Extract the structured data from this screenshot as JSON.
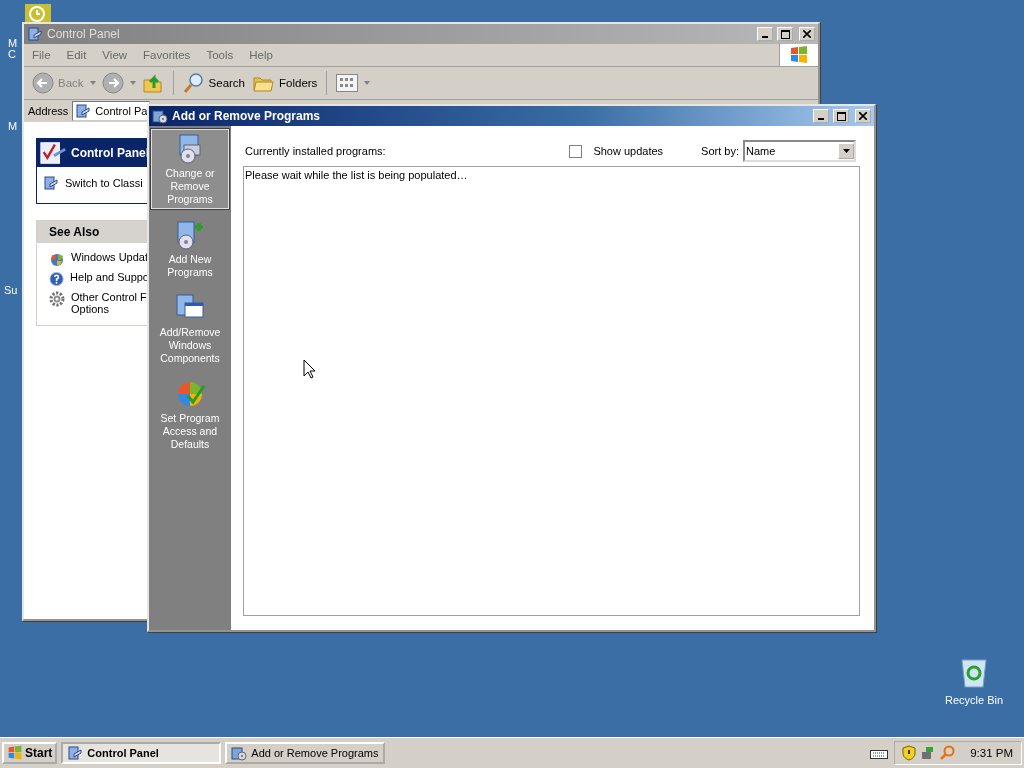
{
  "desktop": {
    "cut_labels": [
      "M",
      "C",
      "M",
      "Su"
    ],
    "icons": [
      {
        "label": "Recycle Bin"
      }
    ]
  },
  "control_panel": {
    "title": "Control Panel",
    "active": false,
    "menu": [
      "File",
      "Edit",
      "View",
      "Favorites",
      "Tools",
      "Help"
    ],
    "toolbar": [
      {
        "kind": "back",
        "label": "Back"
      },
      {
        "kind": "forward"
      },
      {
        "kind": "up"
      },
      {
        "kind": "search",
        "label": "Search"
      },
      {
        "kind": "folders",
        "label": "Folders"
      },
      {
        "kind": "views"
      }
    ],
    "address": {
      "label": "Address",
      "value": "Control Pa"
    },
    "task_box": {
      "title": "Control Panel",
      "link": "Switch to Classi"
    },
    "see_also": {
      "title": "See Also",
      "items": [
        {
          "kind": "update",
          "lines": [
            "Windows Updat"
          ]
        },
        {
          "kind": "help",
          "lines": [
            "Help and Suppo"
          ]
        },
        {
          "kind": "gear",
          "lines": [
            "Other Control F",
            "Options"
          ]
        }
      ]
    }
  },
  "add_remove": {
    "title": "Add or Remove Programs",
    "active": true,
    "sidebar": [
      {
        "kind": "change",
        "lines": [
          "Change or",
          "Remove",
          "Programs"
        ],
        "selected": true
      },
      {
        "kind": "add",
        "lines": [
          "Add New",
          "Programs"
        ],
        "selected": false
      },
      {
        "kind": "components",
        "lines": [
          "Add/Remove",
          "Windows",
          "Components"
        ],
        "selected": false
      },
      {
        "kind": "defaults",
        "lines": [
          "Set Program",
          "Access and",
          "Defaults"
        ],
        "selected": false
      }
    ],
    "heading": "Currently installed programs:",
    "show_updates": {
      "label": "Show updates",
      "checked": false
    },
    "sort": {
      "label": "Sort by:",
      "value": "Name"
    },
    "message": "Please wait while the list is being populated…"
  },
  "taskbar": {
    "start": "Start",
    "tasks": [
      {
        "kind": "control",
        "label": "Control Panel",
        "selected": true
      },
      {
        "kind": "programs",
        "label": "Add or Remove Programs",
        "selected": false
      }
    ],
    "clock": "9:31 PM"
  }
}
